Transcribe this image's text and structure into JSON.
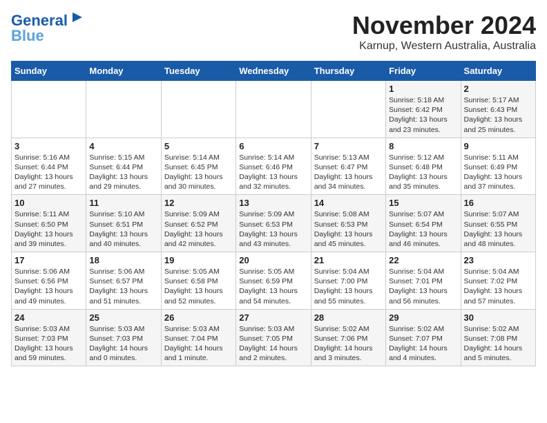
{
  "logo": {
    "line1": "General",
    "line2": "Blue"
  },
  "title": "November 2024",
  "location": "Karnup, Western Australia, Australia",
  "days_of_week": [
    "Sunday",
    "Monday",
    "Tuesday",
    "Wednesday",
    "Thursday",
    "Friday",
    "Saturday"
  ],
  "weeks": [
    [
      {
        "day": "",
        "content": ""
      },
      {
        "day": "",
        "content": ""
      },
      {
        "day": "",
        "content": ""
      },
      {
        "day": "",
        "content": ""
      },
      {
        "day": "",
        "content": ""
      },
      {
        "day": "1",
        "content": "Sunrise: 5:18 AM\nSunset: 6:42 PM\nDaylight: 13 hours\nand 23 minutes."
      },
      {
        "day": "2",
        "content": "Sunrise: 5:17 AM\nSunset: 6:43 PM\nDaylight: 13 hours\nand 25 minutes."
      }
    ],
    [
      {
        "day": "3",
        "content": "Sunrise: 5:16 AM\nSunset: 6:44 PM\nDaylight: 13 hours\nand 27 minutes."
      },
      {
        "day": "4",
        "content": "Sunrise: 5:15 AM\nSunset: 6:44 PM\nDaylight: 13 hours\nand 29 minutes."
      },
      {
        "day": "5",
        "content": "Sunrise: 5:14 AM\nSunset: 6:45 PM\nDaylight: 13 hours\nand 30 minutes."
      },
      {
        "day": "6",
        "content": "Sunrise: 5:14 AM\nSunset: 6:46 PM\nDaylight: 13 hours\nand 32 minutes."
      },
      {
        "day": "7",
        "content": "Sunrise: 5:13 AM\nSunset: 6:47 PM\nDaylight: 13 hours\nand 34 minutes."
      },
      {
        "day": "8",
        "content": "Sunrise: 5:12 AM\nSunset: 6:48 PM\nDaylight: 13 hours\nand 35 minutes."
      },
      {
        "day": "9",
        "content": "Sunrise: 5:11 AM\nSunset: 6:49 PM\nDaylight: 13 hours\nand 37 minutes."
      }
    ],
    [
      {
        "day": "10",
        "content": "Sunrise: 5:11 AM\nSunset: 6:50 PM\nDaylight: 13 hours\nand 39 minutes."
      },
      {
        "day": "11",
        "content": "Sunrise: 5:10 AM\nSunset: 6:51 PM\nDaylight: 13 hours\nand 40 minutes."
      },
      {
        "day": "12",
        "content": "Sunrise: 5:09 AM\nSunset: 6:52 PM\nDaylight: 13 hours\nand 42 minutes."
      },
      {
        "day": "13",
        "content": "Sunrise: 5:09 AM\nSunset: 6:53 PM\nDaylight: 13 hours\nand 43 minutes."
      },
      {
        "day": "14",
        "content": "Sunrise: 5:08 AM\nSunset: 6:53 PM\nDaylight: 13 hours\nand 45 minutes."
      },
      {
        "day": "15",
        "content": "Sunrise: 5:07 AM\nSunset: 6:54 PM\nDaylight: 13 hours\nand 46 minutes."
      },
      {
        "day": "16",
        "content": "Sunrise: 5:07 AM\nSunset: 6:55 PM\nDaylight: 13 hours\nand 48 minutes."
      }
    ],
    [
      {
        "day": "17",
        "content": "Sunrise: 5:06 AM\nSunset: 6:56 PM\nDaylight: 13 hours\nand 49 minutes."
      },
      {
        "day": "18",
        "content": "Sunrise: 5:06 AM\nSunset: 6:57 PM\nDaylight: 13 hours\nand 51 minutes."
      },
      {
        "day": "19",
        "content": "Sunrise: 5:05 AM\nSunset: 6:58 PM\nDaylight: 13 hours\nand 52 minutes."
      },
      {
        "day": "20",
        "content": "Sunrise: 5:05 AM\nSunset: 6:59 PM\nDaylight: 13 hours\nand 54 minutes."
      },
      {
        "day": "21",
        "content": "Sunrise: 5:04 AM\nSunset: 7:00 PM\nDaylight: 13 hours\nand 55 minutes."
      },
      {
        "day": "22",
        "content": "Sunrise: 5:04 AM\nSunset: 7:01 PM\nDaylight: 13 hours\nand 56 minutes."
      },
      {
        "day": "23",
        "content": "Sunrise: 5:04 AM\nSunset: 7:02 PM\nDaylight: 13 hours\nand 57 minutes."
      }
    ],
    [
      {
        "day": "24",
        "content": "Sunrise: 5:03 AM\nSunset: 7:03 PM\nDaylight: 13 hours\nand 59 minutes."
      },
      {
        "day": "25",
        "content": "Sunrise: 5:03 AM\nSunset: 7:03 PM\nDaylight: 14 hours\nand 0 minutes."
      },
      {
        "day": "26",
        "content": "Sunrise: 5:03 AM\nSunset: 7:04 PM\nDaylight: 14 hours\nand 1 minute."
      },
      {
        "day": "27",
        "content": "Sunrise: 5:03 AM\nSunset: 7:05 PM\nDaylight: 14 hours\nand 2 minutes."
      },
      {
        "day": "28",
        "content": "Sunrise: 5:02 AM\nSunset: 7:06 PM\nDaylight: 14 hours\nand 3 minutes."
      },
      {
        "day": "29",
        "content": "Sunrise: 5:02 AM\nSunset: 7:07 PM\nDaylight: 14 hours\nand 4 minutes."
      },
      {
        "day": "30",
        "content": "Sunrise: 5:02 AM\nSunset: 7:08 PM\nDaylight: 14 hours\nand 5 minutes."
      }
    ]
  ]
}
